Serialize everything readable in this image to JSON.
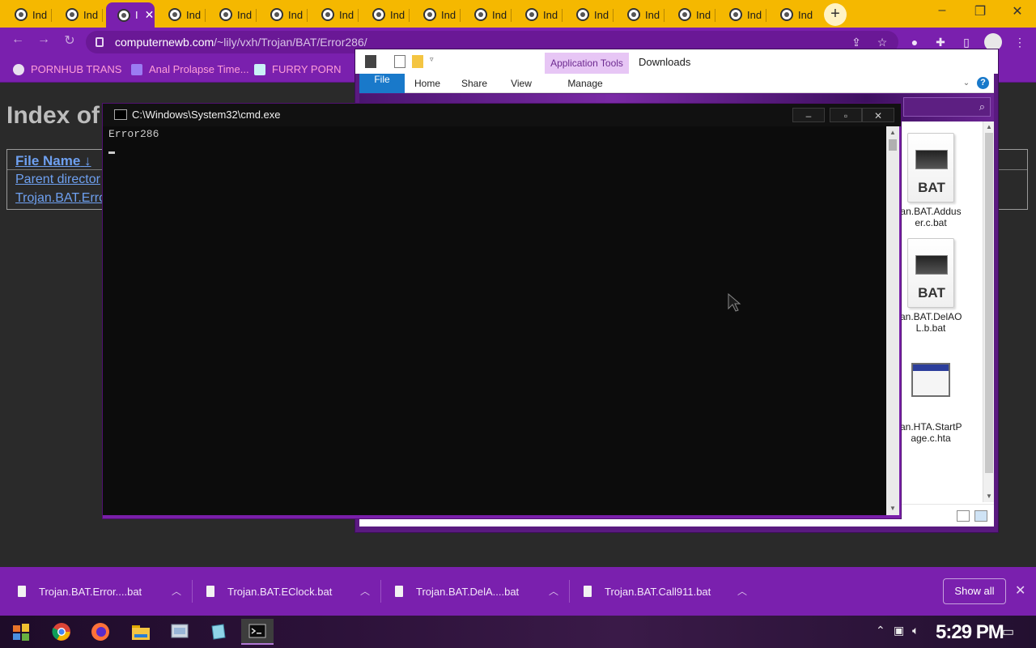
{
  "browser": {
    "tabs": [
      {
        "label": "Ind"
      },
      {
        "label": "Ind"
      },
      {
        "label": "I",
        "active": true
      },
      {
        "label": "Ind"
      },
      {
        "label": "Ind"
      },
      {
        "label": "Ind"
      },
      {
        "label": "Ind"
      },
      {
        "label": "Ind"
      },
      {
        "label": "Ind"
      },
      {
        "label": "Ind"
      },
      {
        "label": "Ind"
      },
      {
        "label": "Ind"
      },
      {
        "label": "Ind"
      },
      {
        "label": "Ind"
      },
      {
        "label": "Ind"
      },
      {
        "label": "Ind"
      }
    ],
    "active_tab_close": "✕",
    "new_tab": "+",
    "url_host": "computernewb.com",
    "url_path": "/~lily/vxh/Trojan/BAT/Error286/",
    "bookmarks": [
      "PORNHUB TRANS",
      "Anal Prolapse Time...",
      "FURRY PORN"
    ],
    "colors": {
      "tabstrip": "#f5b800",
      "theme": "#7a20ae",
      "bookmark_text": "#ff9ed8"
    }
  },
  "page": {
    "title": "Index of",
    "header": "File Name",
    "sort_arrow": "↓",
    "rows": [
      "Parent director",
      "Trojan.BAT.Erro"
    ]
  },
  "explorer": {
    "app_tools": "Application Tools",
    "title": "Downloads",
    "ribbon_tabs": [
      "File",
      "Home",
      "Share",
      "View",
      "Manage"
    ],
    "help": "?",
    "files": [
      {
        "name": "an.BAT.Adduser.c.bat",
        "line1": "an.BAT.Addus",
        "line2": "er.c.bat",
        "icon_label": "BAT"
      },
      {
        "name": "an.BAT.DelAOL.b.bat",
        "line1": "an.BAT.DelAO",
        "line2": "L.b.bat",
        "icon_label": "BAT"
      },
      {
        "name": "an.HTA.StartPage.c.hta",
        "line1": "an.HTA.StartP",
        "line2": "age.c.hta"
      }
    ]
  },
  "cmd": {
    "title": "C:\\Windows\\System32\\cmd.exe",
    "output": "Error286",
    "controls": {
      "minimize": "–",
      "maximize": "▫",
      "close": "✕"
    }
  },
  "downloads_bar": {
    "items": [
      "Trojan.BAT.Error....bat",
      "Trojan.BAT.EClock.bat",
      "Trojan.BAT.DelA....bat",
      "Trojan.BAT.Call911.bat"
    ],
    "show_all": "Show all",
    "close": "✕"
  },
  "taskbar": {
    "apps": [
      "start",
      "chrome",
      "firefox",
      "file-explorer",
      "control-panel",
      "notepad",
      "cmd"
    ],
    "time": "5:29 PM"
  }
}
